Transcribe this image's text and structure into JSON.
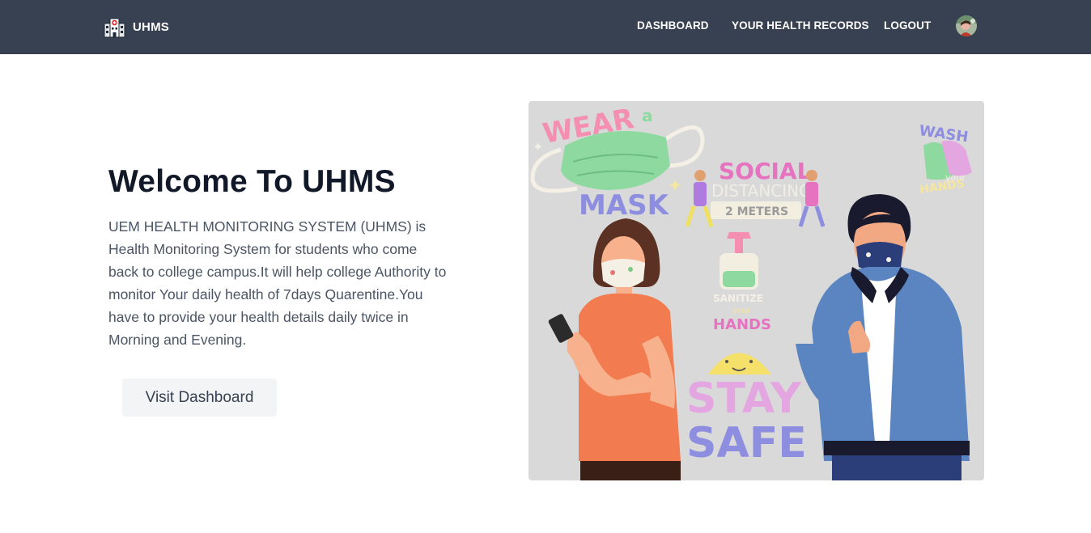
{
  "navbar": {
    "brand": "UHMS",
    "links": [
      "DASHBOARD",
      "YOUR HEALTH RECORDS",
      "LOGOUT"
    ]
  },
  "hero": {
    "title": "Welcome To UHMS",
    "description": "UEM HEALTH MONITORING SYSTEM (UHMS) is Health Monitoring System for students who come back to college campus.It will help college Authority to monitor Your daily health of 7days Quarentine.You have to provide your health details daily twice in Morning and Evening.",
    "button_label": "Visit Dashboard"
  },
  "illustration": {
    "wear": "WEAR",
    "a": "a",
    "mask": "MASK",
    "social": "SOCIAL",
    "distancing": "DISTANCING",
    "meters": "2 METERS",
    "wash": "WASH",
    "your": "your",
    "hands": "HANDS",
    "sanitize": "SANITIZE",
    "sanitize_your": "your",
    "sanitize_hands": "HANDS",
    "stay": "STAY",
    "safe": "SAFE"
  },
  "colors": {
    "navbar_bg": "#374151",
    "button_bg": "#f3f4f6",
    "illustration_bg": "#d9d9d9"
  }
}
